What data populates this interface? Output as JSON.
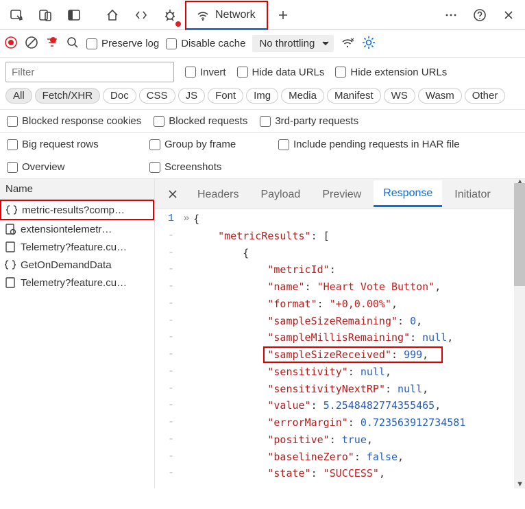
{
  "topTabs": {
    "active": "Network"
  },
  "toolbar": {
    "preserve": "Preserve log",
    "disable": "Disable cache",
    "throttling": "No throttling"
  },
  "filter": {
    "placeholder": "Filter",
    "invert": "Invert",
    "hideData": "Hide data URLs",
    "hideExt": "Hide extension URLs"
  },
  "types": [
    "All",
    "Fetch/XHR",
    "Doc",
    "CSS",
    "JS",
    "Font",
    "Img",
    "Media",
    "Manifest",
    "WS",
    "Wasm",
    "Other"
  ],
  "checksA": [
    "Blocked response cookies",
    "Blocked requests",
    "3rd-party requests"
  ],
  "checksB": [
    "Big request rows",
    "Group by frame",
    "Include pending requests in HAR file"
  ],
  "checksC": [
    "Overview",
    "Screenshots"
  ],
  "sidebar": {
    "head": "Name",
    "items": [
      "metric-results?comp…",
      "extensiontelemetr…",
      "Telemetry?feature.cu…",
      "GetOnDemandData",
      "Telemetry?feature.cu…"
    ]
  },
  "detailTabs": [
    "Headers",
    "Payload",
    "Preview",
    "Response",
    "Initiator"
  ],
  "code": {
    "root": "metricResults",
    "metricId": "metricId",
    "name_key": "name",
    "name_val": "Heart Vote Button",
    "format_key": "format",
    "format_val": "+0,0.00%",
    "ssr_key": "sampleSizeRemaining",
    "ssr_val": "0",
    "smr_key": "sampleMillisRemaining",
    "smr_val": "null",
    "ssrec_key": "sampleSizeReceived",
    "ssrec_val": "999",
    "sens_key": "sensitivity",
    "sens_val": "null",
    "sensn_key": "sensitivityNextRP",
    "sensn_val": "null",
    "val_key": "value",
    "val_val": "5.2548482774355465",
    "em_key": "errorMargin",
    "em_val": "0.723563912734581",
    "pos_key": "positive",
    "pos_val": "true",
    "bz_key": "baselineZero",
    "bz_val": "false",
    "state_key": "state",
    "state_val": "SUCCESS"
  }
}
